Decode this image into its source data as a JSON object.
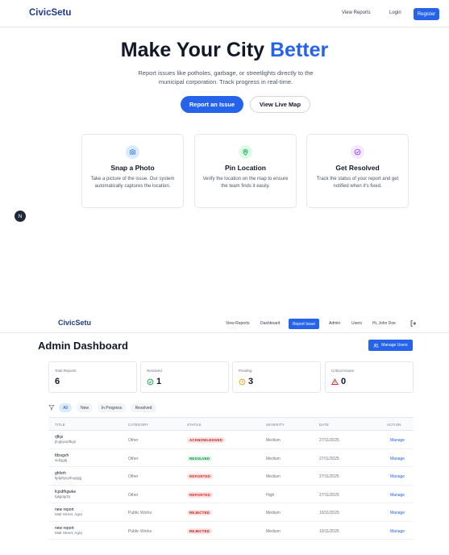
{
  "landing": {
    "brand": "CivicSetu",
    "nav": {
      "view_reports": "View Reports",
      "login": "Login",
      "register": "Register"
    },
    "hero": {
      "title_main": "Make Your City ",
      "title_accent": "Better",
      "subtitle": "Report issues like potholes, garbage, or streetlights directly to the municipal corporation. Track progress in real-time.",
      "primary_button": "Report an Issue",
      "secondary_button": "View Live Map"
    },
    "features": [
      {
        "icon": "camera-icon",
        "title": "Snap a Photo",
        "description": "Take a picture of the issue. Our system automatically captures the location.",
        "color": "#3b82f6",
        "bg": "#dbeafe"
      },
      {
        "icon": "map-pin-icon",
        "title": "Pin Location",
        "description": "Verify the location on the map to ensure the team finds it easily.",
        "color": "#16a34a",
        "bg": "#dcfce7"
      },
      {
        "icon": "check-circle-icon",
        "title": "Get Resolved",
        "description": "Track the status of your report and get notified when it's fixed.",
        "color": "#9333ea",
        "bg": "#f3e8ff"
      }
    ],
    "bubble_letter": "N"
  },
  "admin": {
    "brand": "CivicSetu",
    "nav": {
      "view_reports": "View Reports",
      "dashboard": "Dashboard",
      "report_issue": "Report Issue",
      "admin": "Admin",
      "users": "Users",
      "greeting": "Hi, John Doe"
    },
    "title": "Admin Dashboard",
    "manage_users_button": "Manage Users",
    "stats": [
      {
        "label": "Total Reports",
        "value": "6",
        "icon": ""
      },
      {
        "label": "Resolved",
        "value": "1",
        "icon": "check-circle-icon"
      },
      {
        "label": "Pending",
        "value": "3",
        "icon": "clock-icon"
      },
      {
        "label": "Critical Issues",
        "value": "0",
        "icon": "alert-triangle-icon"
      }
    ],
    "filters": [
      "All",
      "New",
      "In Progress",
      "Resolved"
    ],
    "active_filter": "All",
    "table": {
      "headers": [
        "TITLE",
        "CATEGORY",
        "STATUS",
        "SEVERITY",
        "DATE",
        "ACTION"
      ],
      "rows": [
        {
          "title": "rjfkjv",
          "subtitle": "jfcgkjxsdfkgn",
          "category": "Other",
          "status": "ACKNOWLEDGED",
          "severity": "Medium",
          "date": "27/11/2025",
          "action": "Manage"
        },
        {
          "title": "fdsvgvh",
          "subtitle": "sidzjgdj",
          "category": "Other",
          "status": "RESOLVED",
          "severity": "Medium",
          "date": "27/11/2025",
          "action": "Manage"
        },
        {
          "title": "ghfxrh",
          "subtitle": "kjdjdtyxythugtjyjj",
          "category": "Other",
          "status": "REPORTED",
          "severity": "Medium",
          "date": "27/11/2025",
          "action": "Manage"
        },
        {
          "title": "fcjxdfhgwke",
          "subtitle": "fgkjjdgdzj",
          "category": "Other",
          "status": "REPORTED",
          "severity": "High",
          "date": "27/11/2025",
          "action": "Manage"
        },
        {
          "title": "new report",
          "subtitle": "Mall Street, Agra",
          "category": "Public Works",
          "status": "REJECTED",
          "severity": "Medium",
          "date": "10/11/2025",
          "action": "Manage"
        },
        {
          "title": "new report",
          "subtitle": "Mall Street, Agra",
          "category": "Public Works",
          "status": "REJECTED",
          "severity": "Medium",
          "date": "10/11/2025",
          "action": "Manage"
        }
      ]
    }
  },
  "colors": {
    "primary": "#2563eb",
    "brand": "#1e3a8a",
    "success": "#16a34a",
    "warning": "#f59e0b",
    "danger": "#dc2626"
  }
}
